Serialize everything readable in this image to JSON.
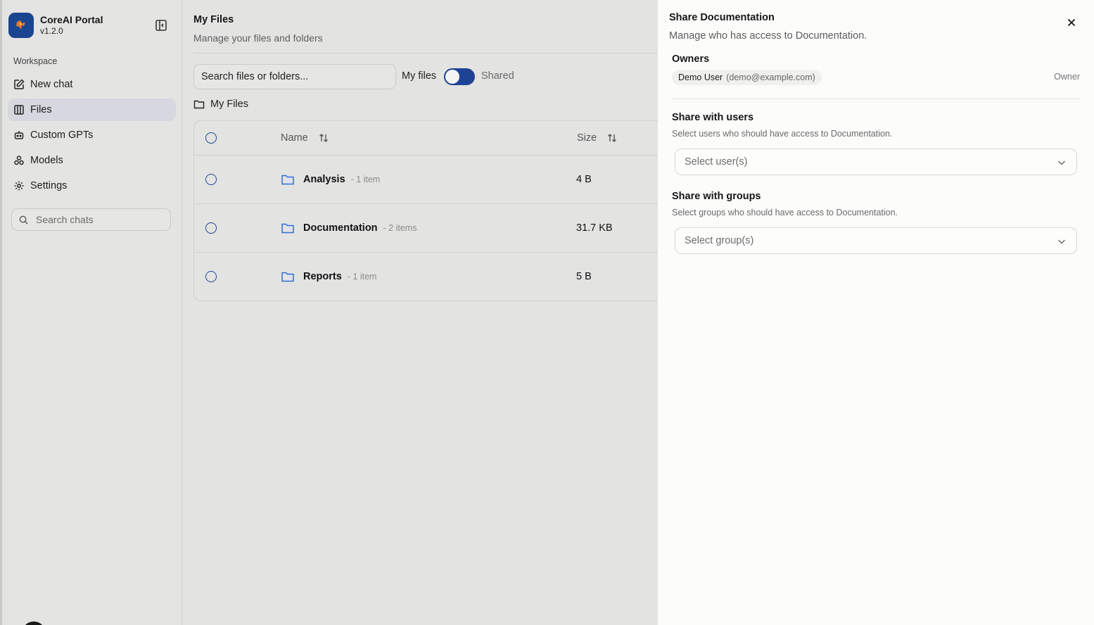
{
  "app": {
    "title": "CoreAI Portal",
    "version": "v1.2.0"
  },
  "sidebar": {
    "section_label": "Workspace",
    "items": [
      {
        "label": "New chat",
        "icon": "edit-icon"
      },
      {
        "label": "Files",
        "icon": "files-icon",
        "active": true
      },
      {
        "label": "Custom GPTs",
        "icon": "bot-icon"
      },
      {
        "label": "Models",
        "icon": "models-icon"
      },
      {
        "label": "Settings",
        "icon": "gear-icon"
      }
    ],
    "search_placeholder": "Search chats"
  },
  "main": {
    "title": "My Files",
    "subtitle": "Manage your files and folders",
    "search_placeholder": "Search files or folders...",
    "toggle": {
      "left_label": "My files",
      "right_label": "Shared"
    },
    "breadcrumb": "My Files",
    "table": {
      "columns": {
        "name": "Name",
        "size": "Size"
      },
      "rows": [
        {
          "name": "Analysis",
          "count": "- 1 item",
          "size": "4 B"
        },
        {
          "name": "Documentation",
          "count": "- 2 items",
          "size": "31.7 KB"
        },
        {
          "name": "Reports",
          "count": "- 1 item",
          "size": "5 B"
        }
      ]
    }
  },
  "panel": {
    "title": "Share Documentation",
    "subtitle": "Manage who has access to Documentation.",
    "owners_label": "Owners",
    "owner": {
      "name": "Demo User",
      "email": "(demo@example.com)",
      "role": "Owner"
    },
    "users": {
      "title": "Share with users",
      "description": "Select users who should have access to Documentation.",
      "placeholder": "Select user(s)"
    },
    "groups": {
      "title": "Share with groups",
      "description": "Select groups who should have access to Documentation.",
      "placeholder": "Select group(s)"
    }
  },
  "colors": {
    "accent": "#1d4494",
    "folder": "#2f6fd6",
    "logo_bg": "#1c4591"
  }
}
